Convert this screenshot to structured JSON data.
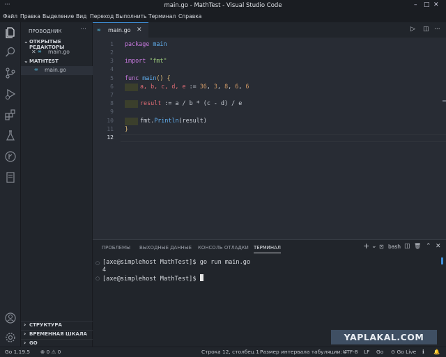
{
  "window": {
    "title": "main.go - MathTest - Visual Studio Code",
    "more_glyph": "···"
  },
  "menu": [
    "Файл",
    "Правка",
    "Выделение",
    "Вид",
    "Переход",
    "Выполнить",
    "Терминал",
    "Справка"
  ],
  "activity_bar": [
    "explorer-icon",
    "search-icon",
    "source-control-icon",
    "run-debug-icon",
    "extensions-icon",
    "testing-icon",
    "git-graph-icon",
    "notebook-icon",
    "account-icon",
    "settings-gear-icon"
  ],
  "sidebar": {
    "header": "ПРОВОДНИК",
    "more": "···",
    "open_editors": {
      "label": "ОТКРЫТЫЕ РЕДАКТОРЫ",
      "files": [
        {
          "close": "✕",
          "icon": "∞",
          "name": "main.go"
        }
      ]
    },
    "project": {
      "label": "MATHTEST",
      "files": [
        {
          "icon": "∞",
          "name": "main.go"
        }
      ]
    },
    "bottom_sections": [
      "СТРУКТУРА",
      "ВРЕМЕННАЯ ШКАЛА",
      "GO"
    ]
  },
  "editor": {
    "tab": {
      "icon": "∞",
      "label": "main.go",
      "close": "✕"
    },
    "actions": {
      "run": "▷",
      "split": "◫",
      "more": "···"
    },
    "line_numbers": [
      "1",
      "2",
      "3",
      "4",
      "5",
      "6",
      "7",
      "8",
      "9",
      "10",
      "11",
      "12"
    ],
    "current_line": "12",
    "code": {
      "l1": [
        "package",
        " main"
      ],
      "l3": [
        "import",
        " ",
        "\"fmt\""
      ],
      "l5": [
        "func",
        " ",
        "main",
        "()",
        " {"
      ],
      "l6": [
        "a, b, c, d, e",
        " := ",
        "36",
        ", ",
        "3",
        ", ",
        "8",
        ", ",
        "6",
        ", ",
        "6"
      ],
      "l8": [
        "result",
        " := ",
        "a / b * (c - d) / e"
      ],
      "l10": [
        "fmt",
        ".",
        "Println",
        "(result)"
      ],
      "l11": [
        "}"
      ]
    }
  },
  "panel": {
    "tabs": [
      "ПРОБЛЕМЫ",
      "ВЫХОДНЫЕ ДАННЫЕ",
      "КОНСОЛЬ ОТЛАДКИ",
      "ТЕРМИНАЛ"
    ],
    "active_tab": "ТЕРМИНАЛ",
    "controls": {
      "add": "+",
      "dropdown": "⌄",
      "shell_label": "bash",
      "split": "◫",
      "trash": "🗑",
      "maximize": "⌃",
      "close": "✕"
    },
    "terminal": [
      "[axe@simplehost MathTest]$ go run main.go",
      "4",
      "[axe@simplehost MathTest]$ "
    ]
  },
  "status": {
    "go_version": "Go 1.19.5",
    "problems": "⊗ 0 ⚠ 0",
    "line_col": "Строка 12, столбец 1",
    "tab_size": "Размер интервала табуляции: 4",
    "encoding": "UTF-8",
    "eol": "LF",
    "language": "Go",
    "go_live": "⊙ Go Live",
    "feedback": "ℹ",
    "bell": "🔔"
  },
  "watermark": "YAPLAKAL.COM",
  "colors": {
    "accent": "#3f8fd9",
    "keyword": "#c678dd",
    "function": "#61afef",
    "string": "#98c379",
    "number": "#d19a66",
    "variable": "#e06c75"
  }
}
